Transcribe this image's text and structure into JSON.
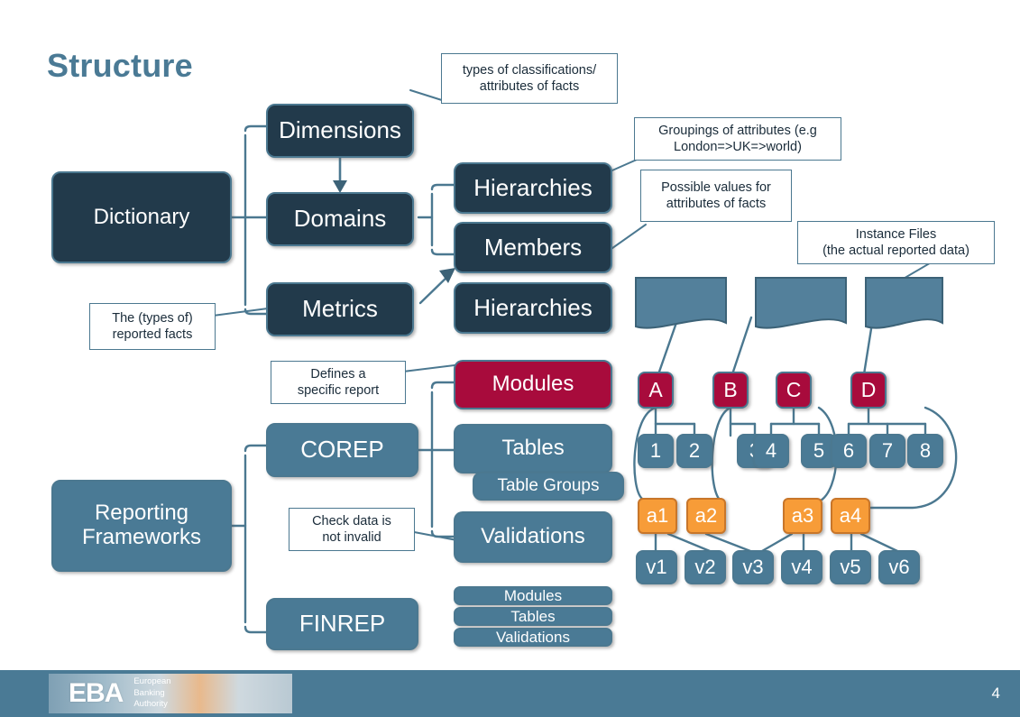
{
  "slide": {
    "title": "Structure",
    "page_number": "4",
    "background": "#ffffff"
  },
  "colors": {
    "dark_navy": "#223A4B",
    "steel_blue": "#4A7A95",
    "crimson": "#A80B3C",
    "orange": "#F79C38",
    "border": "#4B7890",
    "title_text": "#4A7A95"
  },
  "nodes": {
    "dictionary": "Dictionary",
    "dimensions": "Dimensions",
    "domains": "Domains",
    "metrics": "Metrics",
    "hierarchies_domains": "Hierarchies",
    "members": "Members",
    "hierarchies_metrics": "Hierarchies",
    "reporting_frameworks": "Reporting\nFrameworks",
    "corep": "COREP",
    "finrep": "FINREP",
    "modules": "Modules",
    "tables": "Tables",
    "table_groups": "Table Groups",
    "validations": "Validations",
    "finrep_list": [
      "Modules",
      "Tables",
      "Validations"
    ]
  },
  "callouts": {
    "dimensions_note": "types of classifications/\nattributes  of facts",
    "hierarchies_note": "Groupings of attributes (e.g\nLondon=>UK=>world)",
    "members_note": "Possible values for\nattributes of facts",
    "metrics_note": "The (types of)\nreported facts",
    "modules_note": "Defines a\nspecific report",
    "validations_note": "Check data is\nnot invalid",
    "instance_files_note": "Instance Files\n(the actual reported data)"
  },
  "instance_tree": {
    "documents": 3,
    "modules": [
      "A",
      "B",
      "C",
      "D"
    ],
    "tables": [
      "1",
      "2",
      "3",
      "4",
      "5",
      "6",
      "7",
      "8"
    ],
    "table_groups": [
      "a1",
      "a2",
      "a3",
      "a4"
    ],
    "validations": [
      "v1",
      "v2",
      "v3",
      "v4",
      "v5",
      "v6"
    ],
    "module_to_tables": {
      "A": [
        "1",
        "2"
      ],
      "B": [
        "3"
      ],
      "C": [
        "4",
        "5"
      ],
      "D": [
        "6",
        "7",
        "8"
      ]
    },
    "group_to_validations": {
      "a1": [
        "v1",
        "v2"
      ],
      "a2": [
        "v3"
      ],
      "a3": [
        "v3",
        "v4"
      ],
      "a4": [
        "v5",
        "v6"
      ]
    }
  },
  "footer": {
    "logo_text": "EBA",
    "logo_subtitle": "European\nBanking\nAuthority"
  }
}
